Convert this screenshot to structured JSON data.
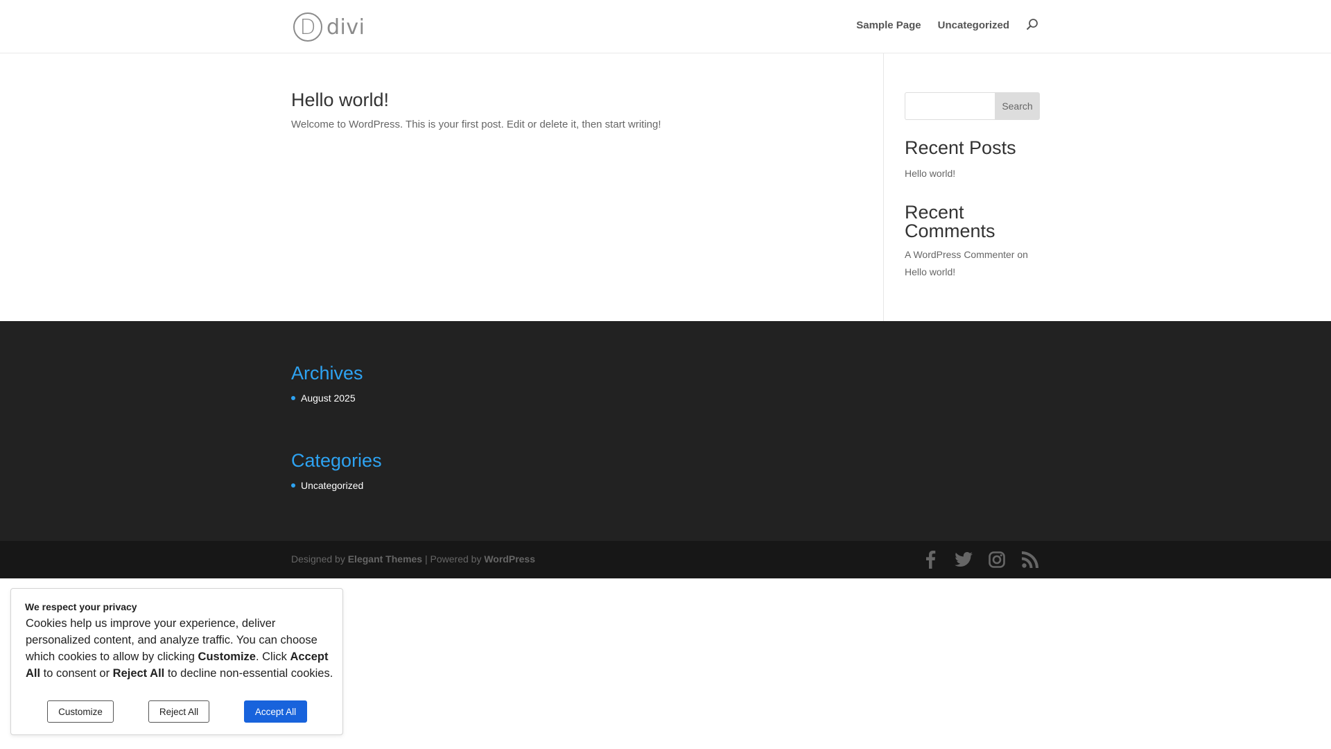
{
  "header": {
    "logo_letter": "D",
    "logo_text": "divi",
    "nav": [
      "Sample Page",
      "Uncategorized"
    ]
  },
  "post": {
    "title": "Hello world!",
    "excerpt": "Welcome to WordPress. This is your first post. Edit or delete it, then start writing!"
  },
  "sidebar": {
    "search_button": "Search",
    "search_value": "",
    "recent_posts_heading": "Recent Posts",
    "recent_posts": [
      "Hello world!"
    ],
    "recent_comments_heading_line1": "Recent",
    "recent_comments_heading_line2": "Comments",
    "comment_author": "A WordPress Commenter",
    "comment_on": "on",
    "comment_post": "Hello world!"
  },
  "footer": {
    "archives_heading": "Archives",
    "archives": [
      "August 2025"
    ],
    "categories_heading": "Categories",
    "categories": [
      "Uncategorized"
    ]
  },
  "bottom": {
    "designed_by": "Designed by",
    "elegant_themes": "Elegant Themes",
    "powered_by": "| Powered by",
    "wordpress": "WordPress",
    "social_icons": [
      "facebook-icon",
      "twitter-icon",
      "instagram-icon",
      "rss-icon"
    ]
  },
  "cookie": {
    "title": "We respect your privacy",
    "text_1": "Cookies help us improve your experience, deliver personalized content, and analyze traffic. You can choose which cookies to allow by clicking ",
    "bold_customize": "Customize",
    "text_2": ". Click ",
    "bold_accept": "Accept All",
    "text_3": " to consent or ",
    "bold_reject": "Reject All",
    "text_4": " to decline non-essential cookies.",
    "btn_customize": "Customize",
    "btn_reject": "Reject All",
    "btn_accept": "Accept All"
  },
  "colors": {
    "accent": "#2ea3f2",
    "footer_bg": "#222222",
    "bottom_bg": "#171717",
    "accept_btn": "#1863dc"
  }
}
